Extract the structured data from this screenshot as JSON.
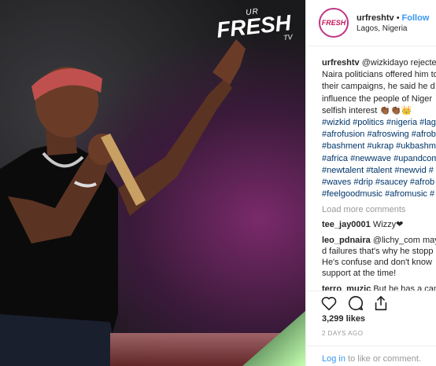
{
  "photo": {
    "logo_top": "UR",
    "logo_main": "FRESH",
    "logo_bottom": "TV"
  },
  "header": {
    "avatar_text": "FRESH",
    "username": "urfreshtv",
    "separator": "•",
    "follow_label": "Follow",
    "location": "Lagos, Nigeria"
  },
  "caption": {
    "username": "urfreshtv",
    "lines": [
      "@wizkidayo rejected",
      "Naira politicians offered him to",
      "their campaigns, he said he d",
      "influence the people of Niger",
      "selfish interest 👏🏾👏🏾👑"
    ],
    "hashtag_lines": [
      "#wizkid #politics #nigeria #lag",
      "#afrofusion #afroswing #afrob",
      "#bashment #ukrap #ukbashm",
      "#africa #newwave #upandcom",
      "#newtalent #talent #newvid #",
      "#waves #drip #saucey #afrob",
      "#feelgoodmusic #afromusic #"
    ]
  },
  "load_more": "Load more comments",
  "comments": [
    {
      "user": "tee_jay0001",
      "text": "Wizzy❤"
    },
    {
      "user": "leo_pdnaira",
      "text": "@lichy_com may",
      "more": [
        "d failures that's why he stopp",
        "He's confuse and don't know",
        "support at the time!"
      ]
    },
    {
      "user": "terro_muzic",
      "text": "But he has a cand"
    }
  ],
  "actions": {
    "like_icon": "heart-icon",
    "comment_icon": "comment-icon",
    "share_icon": "share-icon"
  },
  "likes": "3,299 likes",
  "date": "2 DAYS AGO",
  "footer": {
    "login": "Log in",
    "rest": " to like or comment."
  }
}
